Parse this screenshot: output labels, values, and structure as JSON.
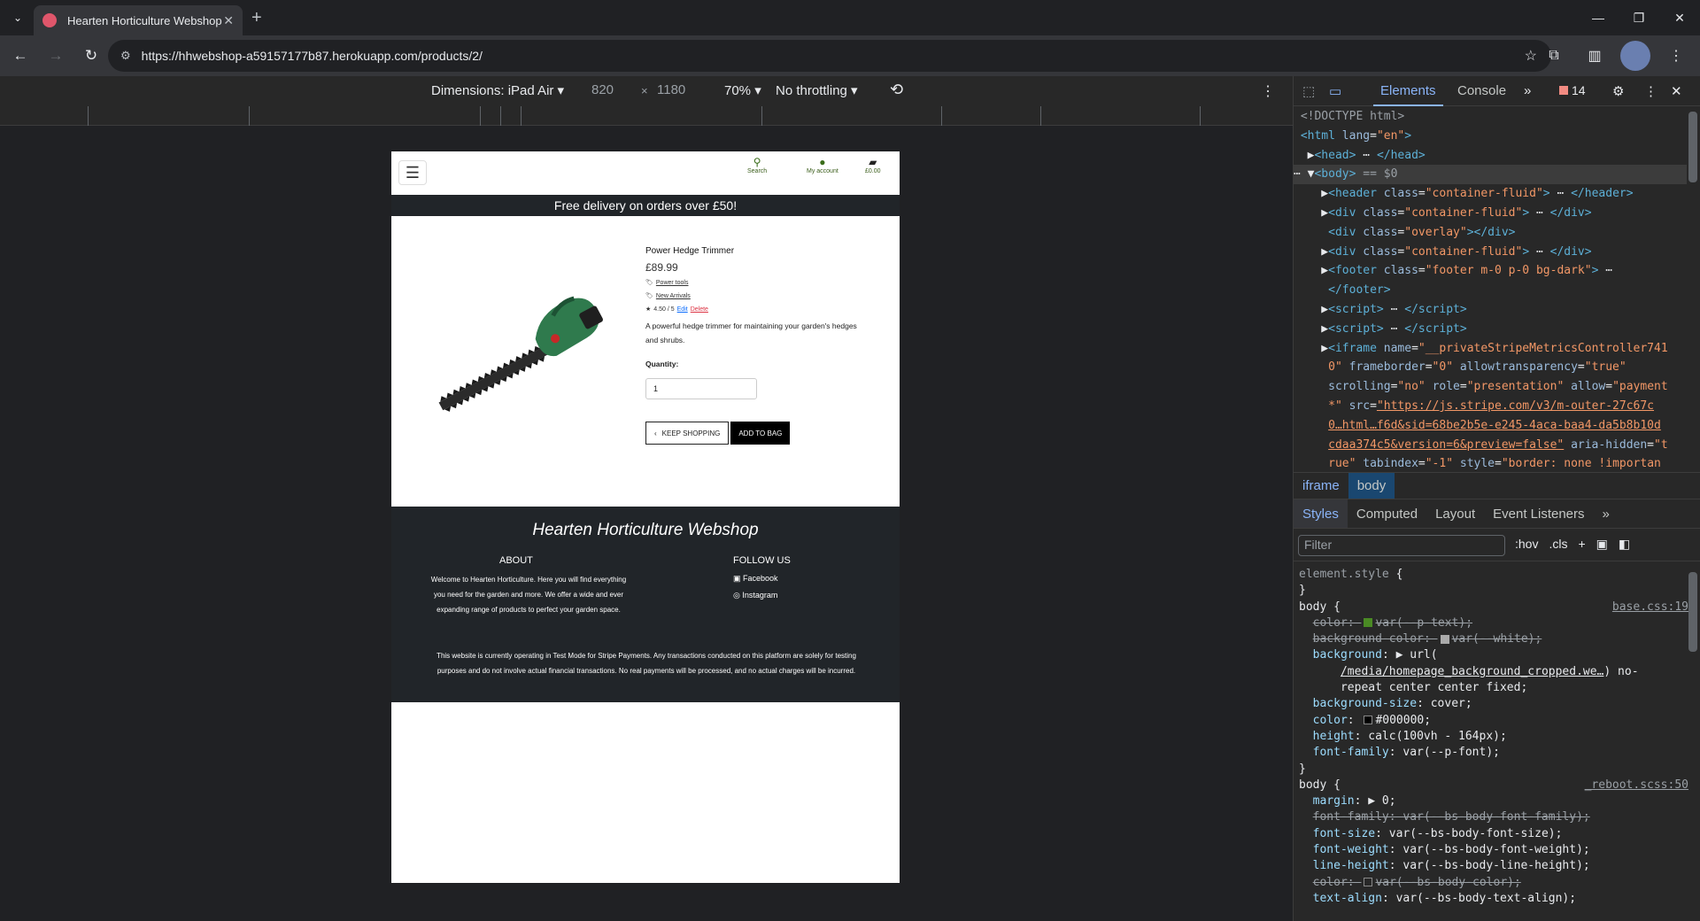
{
  "browser": {
    "tab_title": "Hearten Horticulture Webshop",
    "url": "https://hhwebshop-a59157177b87.herokuapp.com/products/2/"
  },
  "device_toolbar": {
    "dimensions_label": "Dimensions: iPad Air ▾",
    "width": "820",
    "times": "×",
    "height": "1180",
    "zoom": "70% ▾",
    "throttling": "No throttling ▾"
  },
  "site": {
    "header": {
      "search_label": "Search",
      "account_label": "My account",
      "bag_total": "£0.00"
    },
    "promo": "Free delivery on orders over £50!",
    "product": {
      "name": "Power Hedge Trimmer",
      "price": "£89.99",
      "category": "Power tools",
      "tag": "New Arrivals",
      "rating": "4.50 / 5",
      "edit_label": "Edit",
      "delete_label": "Delete",
      "description": "A powerful hedge trimmer for maintaining your garden's hedges and shrubs.",
      "quantity_label": "Quantity:",
      "quantity_value": "1",
      "keep_shopping": "KEEP SHOPPING",
      "add_to_bag": "ADD TO BAG"
    },
    "footer": {
      "brand": "Hearten Horticulture Webshop",
      "about_heading": "ABOUT",
      "about_text": "Welcome to Hearten Horticulture. Here you will find everything you need for the garden and more. We offer a wide and ever expanding range of products to perfect your garden space.",
      "follow_heading": "FOLLOW US",
      "facebook": "Facebook",
      "instagram": "Instagram",
      "disclaimer": "This website is currently operating in Test Mode for Stripe Payments. Any transactions conducted on this platform are solely for testing purposes and do not involve actual financial transactions. No real payments will be processed, and no actual charges will be incurred."
    }
  },
  "devtools": {
    "tabs": [
      "Elements",
      "Console"
    ],
    "issues_count": "14",
    "breadcrumbs": [
      "iframe",
      "body"
    ],
    "subtabs": [
      "Styles",
      "Computed",
      "Layout",
      "Event Listeners"
    ],
    "filter_placeholder": "Filter",
    "hov": ":hov",
    "cls": ".cls",
    "source_base": "base.css:19",
    "source_reboot": "_reboot.scss:50"
  }
}
